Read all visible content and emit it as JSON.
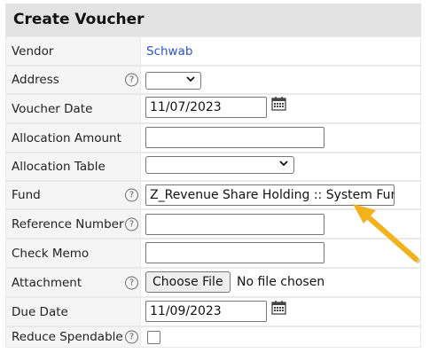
{
  "form": {
    "title": "Create Voucher",
    "help_glyph": "?",
    "vendor": {
      "label": "Vendor",
      "value": "Schwab"
    },
    "address": {
      "label": "Address",
      "selected": ""
    },
    "voucher_date": {
      "label": "Voucher Date",
      "value": "11/07/2023"
    },
    "allocation_amount": {
      "label": "Allocation Amount",
      "value": ""
    },
    "allocation_table": {
      "label": "Allocation Table",
      "selected": ""
    },
    "fund": {
      "label": "Fund",
      "value": "Z_Revenue Share Holding :: System Fur"
    },
    "reference_number": {
      "label": "Reference Number",
      "value": ""
    },
    "check_memo": {
      "label": "Check Memo",
      "value": ""
    },
    "attachment": {
      "label": "Attachment",
      "button_label": "Choose File",
      "status": "No file chosen"
    },
    "due_date": {
      "label": "Due Date",
      "value": "11/09/2023"
    },
    "reduce_spendable": {
      "label": "Reduce Spendable",
      "checked": false
    }
  },
  "colors": {
    "link": "#2d55c4",
    "annotation_arrow": "#f2b21c"
  },
  "icons": {
    "calendar": "calendar-icon",
    "help": "help-icon",
    "dropdown": "chevron-down-icon"
  }
}
